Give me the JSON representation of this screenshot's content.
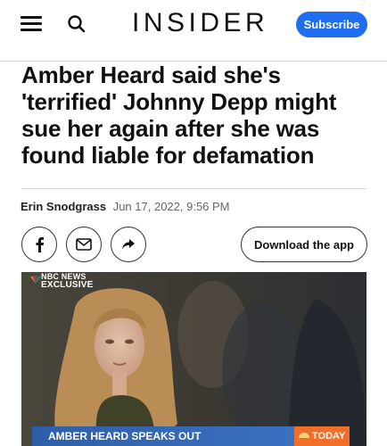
{
  "header": {
    "brand": "INSIDER",
    "subscribe_label": "Subscribe",
    "menu_icon": "hamburger-menu-icon",
    "search_icon": "search-icon",
    "accent_color": "#1f6ef0"
  },
  "article": {
    "headline": "Amber Heard said she's 'terrified' Johnny Depp might sue her again after she was found liable for defamation",
    "author": "Erin Snodgrass",
    "date": "Jun 17, 2022, 9:56 PM"
  },
  "share": {
    "facebook_icon": "facebook-icon",
    "email_icon": "email-icon",
    "share_icon": "share-arrow-icon",
    "download_label": "Download the app"
  },
  "video": {
    "network_line1": "NBC NEWS",
    "network_line2": "EXCLUSIVE",
    "lower_third": "AMBER HEARD SPEAKS OUT",
    "show_badge": "TODAY"
  }
}
